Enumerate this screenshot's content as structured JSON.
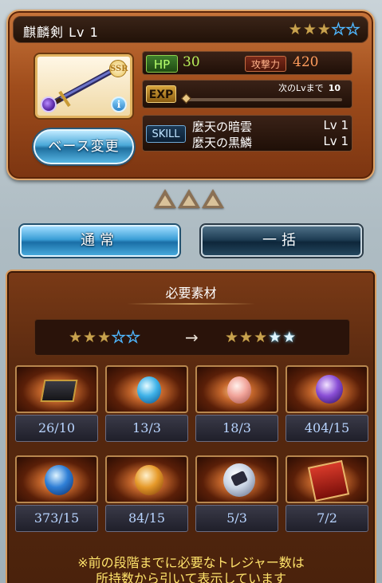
{
  "weapon": {
    "name": "麒麟剣",
    "level": "Lv 1",
    "rarity_badge": "SSR",
    "current_stars": {
      "filled": 3,
      "empty": 2
    },
    "hp_label": "HP",
    "hp": "30",
    "atk_label": "攻撃力",
    "atk": "420",
    "exp_label": "EXP",
    "exp_next_label": "次のLvまで",
    "exp_next_value": "10",
    "exp_progress": 0.0,
    "skill_label": "SKILL",
    "skills": [
      {
        "name": "麼天の暗雲",
        "level": "Lv 1"
      },
      {
        "name": "麼天の黒鱗",
        "level": "Lv 1"
      }
    ],
    "base_change_label": "ベース変更"
  },
  "uncap_level": 3,
  "mode": {
    "normal_label": "通常",
    "bulk_label": "一括"
  },
  "materials": {
    "title": "必要素材",
    "star_from": {
      "filled": 3,
      "empty": 2
    },
    "star_to": {
      "filled": 3,
      "bright": 2
    },
    "arrow": "→",
    "items": [
      {
        "icon": "dark-chest-icon",
        "count": "26/10"
      },
      {
        "icon": "blue-wind-orb-icon",
        "count": "13/3"
      },
      {
        "icon": "pink-light-orb-icon",
        "count": "18/3"
      },
      {
        "icon": "purple-dark-orb-icon",
        "count": "404/15"
      },
      {
        "icon": "blue-water-orb-icon",
        "count": "373/15"
      },
      {
        "icon": "orange-earth-orb-icon",
        "count": "84/15"
      },
      {
        "icon": "silver-scale-orb-icon",
        "count": "5/3"
      },
      {
        "icon": "red-scroll-icon",
        "count": "7/2"
      }
    ],
    "note_line1": "※前の段階までに必要なトレジャー数は",
    "note_line2": "所持数から引いて表示しています"
  },
  "colors": {
    "card_brown": "#a04d1c",
    "hp_green": "#b9f05a",
    "atk_orange": "#ff9c5c",
    "note_yellow": "#ffe36b",
    "count_blue": "#b8d4ff"
  }
}
